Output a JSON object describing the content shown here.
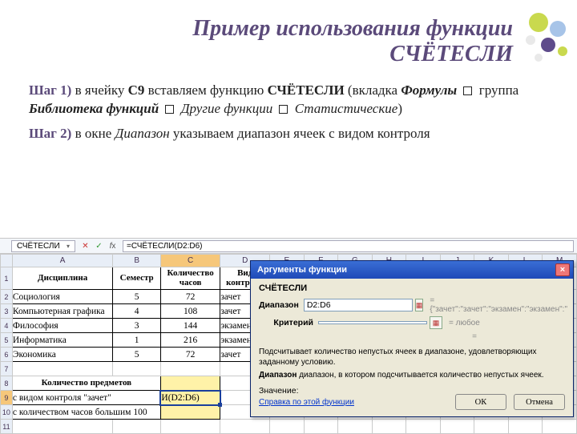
{
  "title_line1": "Пример использования функции",
  "title_line2": "СЧЁТЕСЛИ",
  "step1": {
    "label": "Шаг 1)",
    "t1": " в ячейку ",
    "cell": "C9",
    "t2": " вставляем функцию ",
    "fn": "СЧЁТЕСЛИ",
    "t3": " (вкладка ",
    "tab": "Формулы",
    "t4": " группа ",
    "group": "Библиотека функций",
    "menu1": "Другие функции",
    "menu2": "Статистические",
    "t5": ")"
  },
  "step2": {
    "label": "Шаг 2)",
    "t1": " в окне ",
    "field": "Диапазон",
    "t2": " указываем диапазон ячеек с видом контроля"
  },
  "excel": {
    "namebox": "СЧЁТЕСЛИ",
    "formula": "=СЧЁТЕСЛИ(D2:D6)",
    "columns": [
      "A",
      "B",
      "C",
      "D",
      "E",
      "F",
      "G",
      "H",
      "I",
      "J",
      "K",
      "L",
      "M"
    ],
    "headers": {
      "A": "Дисциплина",
      "B": "Семестр",
      "C": "Количество часов",
      "D": "Вид контроля"
    },
    "rows": [
      {
        "A": "Социология",
        "B": "5",
        "C": "72",
        "D": "зачет"
      },
      {
        "A": "Компьютерная графика",
        "B": "4",
        "C": "108",
        "D": "зачет"
      },
      {
        "A": "Философия",
        "B": "3",
        "C": "144",
        "D": "экзамен"
      },
      {
        "A": "Информатика",
        "B": "1",
        "C": "216",
        "D": "экзамен"
      },
      {
        "A": "Экономика",
        "B": "5",
        "C": "72",
        "D": "зачет"
      }
    ],
    "block2_title": "Количество предметов",
    "block2_r9": "с видом контроля \"зачет\"",
    "block2_r10": "с количеством часов большим 100",
    "c9_display": "И(D2:D6)"
  },
  "dialog": {
    "title": "Аргументы функции",
    "fn_name": "СЧЁТЕСЛИ",
    "param1_label": "Диапазон",
    "param1_value": "D2:D6",
    "param1_result": "= {\"зачет\":\"зачет\":\"экзамен\":\"экзамен\":\"",
    "param2_label": "Критерий",
    "param2_value": "",
    "param2_result": "= любое",
    "eq": "=",
    "desc": "Подсчитывает количество непустых ячеек в диапазоне, удовлетворяющих заданному условию.",
    "desc2_label": "Диапазон",
    "desc2_text": " диапазон, в котором подсчитывается количество непустых ячеек.",
    "result_label": "Значение:",
    "help_link": "Справка по этой функции",
    "ok": "ОК",
    "cancel": "Отмена"
  }
}
